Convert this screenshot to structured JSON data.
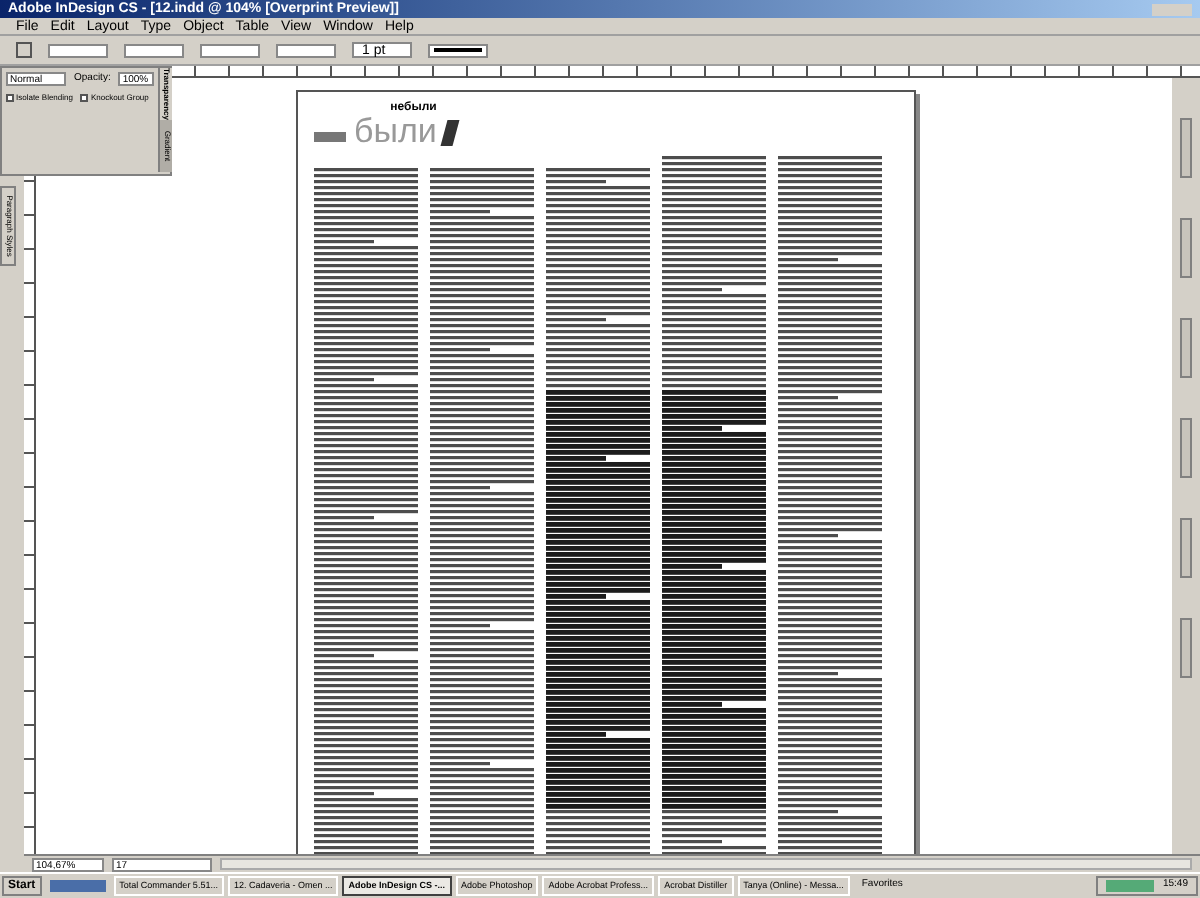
{
  "window": {
    "title": "Adobe InDesign CS - [12.indd @ 104% [Overprint Preview]]"
  },
  "menu": [
    {
      "label": "File"
    },
    {
      "label": "Edit"
    },
    {
      "label": "Layout"
    },
    {
      "label": "Type"
    },
    {
      "label": "Object"
    },
    {
      "label": "Table"
    },
    {
      "label": "View"
    },
    {
      "label": "Window"
    },
    {
      "label": "Help"
    }
  ],
  "control_bar": {
    "stroke_weight": "1 pt"
  },
  "transparency_panel": {
    "blend_mode": "Normal",
    "opacity_label": "Opacity:",
    "opacity": "100%",
    "options": [
      {
        "label": "Isolate Blending",
        "checked": false
      },
      {
        "label": "Knockout Group",
        "checked": false
      }
    ],
    "tabs": [
      {
        "label": "Transparency",
        "selected": true
      },
      {
        "label": "Gradient",
        "selected": false
      }
    ]
  },
  "side_tab": {
    "label": "Paragraph Styles"
  },
  "page": {
    "kicker": "небыли",
    "headline": "были"
  },
  "status_bar": {
    "zoom": "104,67%",
    "page": "17"
  },
  "taskbar": {
    "start": "Start",
    "items": [
      {
        "label": "Total Commander 5.51...",
        "selected": false
      },
      {
        "label": "12. Cadaveria - Omen ...",
        "selected": false
      },
      {
        "label": "Adobe InDesign CS -...",
        "selected": true
      },
      {
        "label": "Adobe Photoshop",
        "selected": false
      },
      {
        "label": "Adobe Acrobat Profess...",
        "selected": false
      },
      {
        "label": "Acrobat Distiller",
        "selected": false
      },
      {
        "label": "Tanya (Online) - Messa...",
        "selected": false
      }
    ],
    "toolbar_label": "Favorites",
    "clock": "15:49"
  }
}
